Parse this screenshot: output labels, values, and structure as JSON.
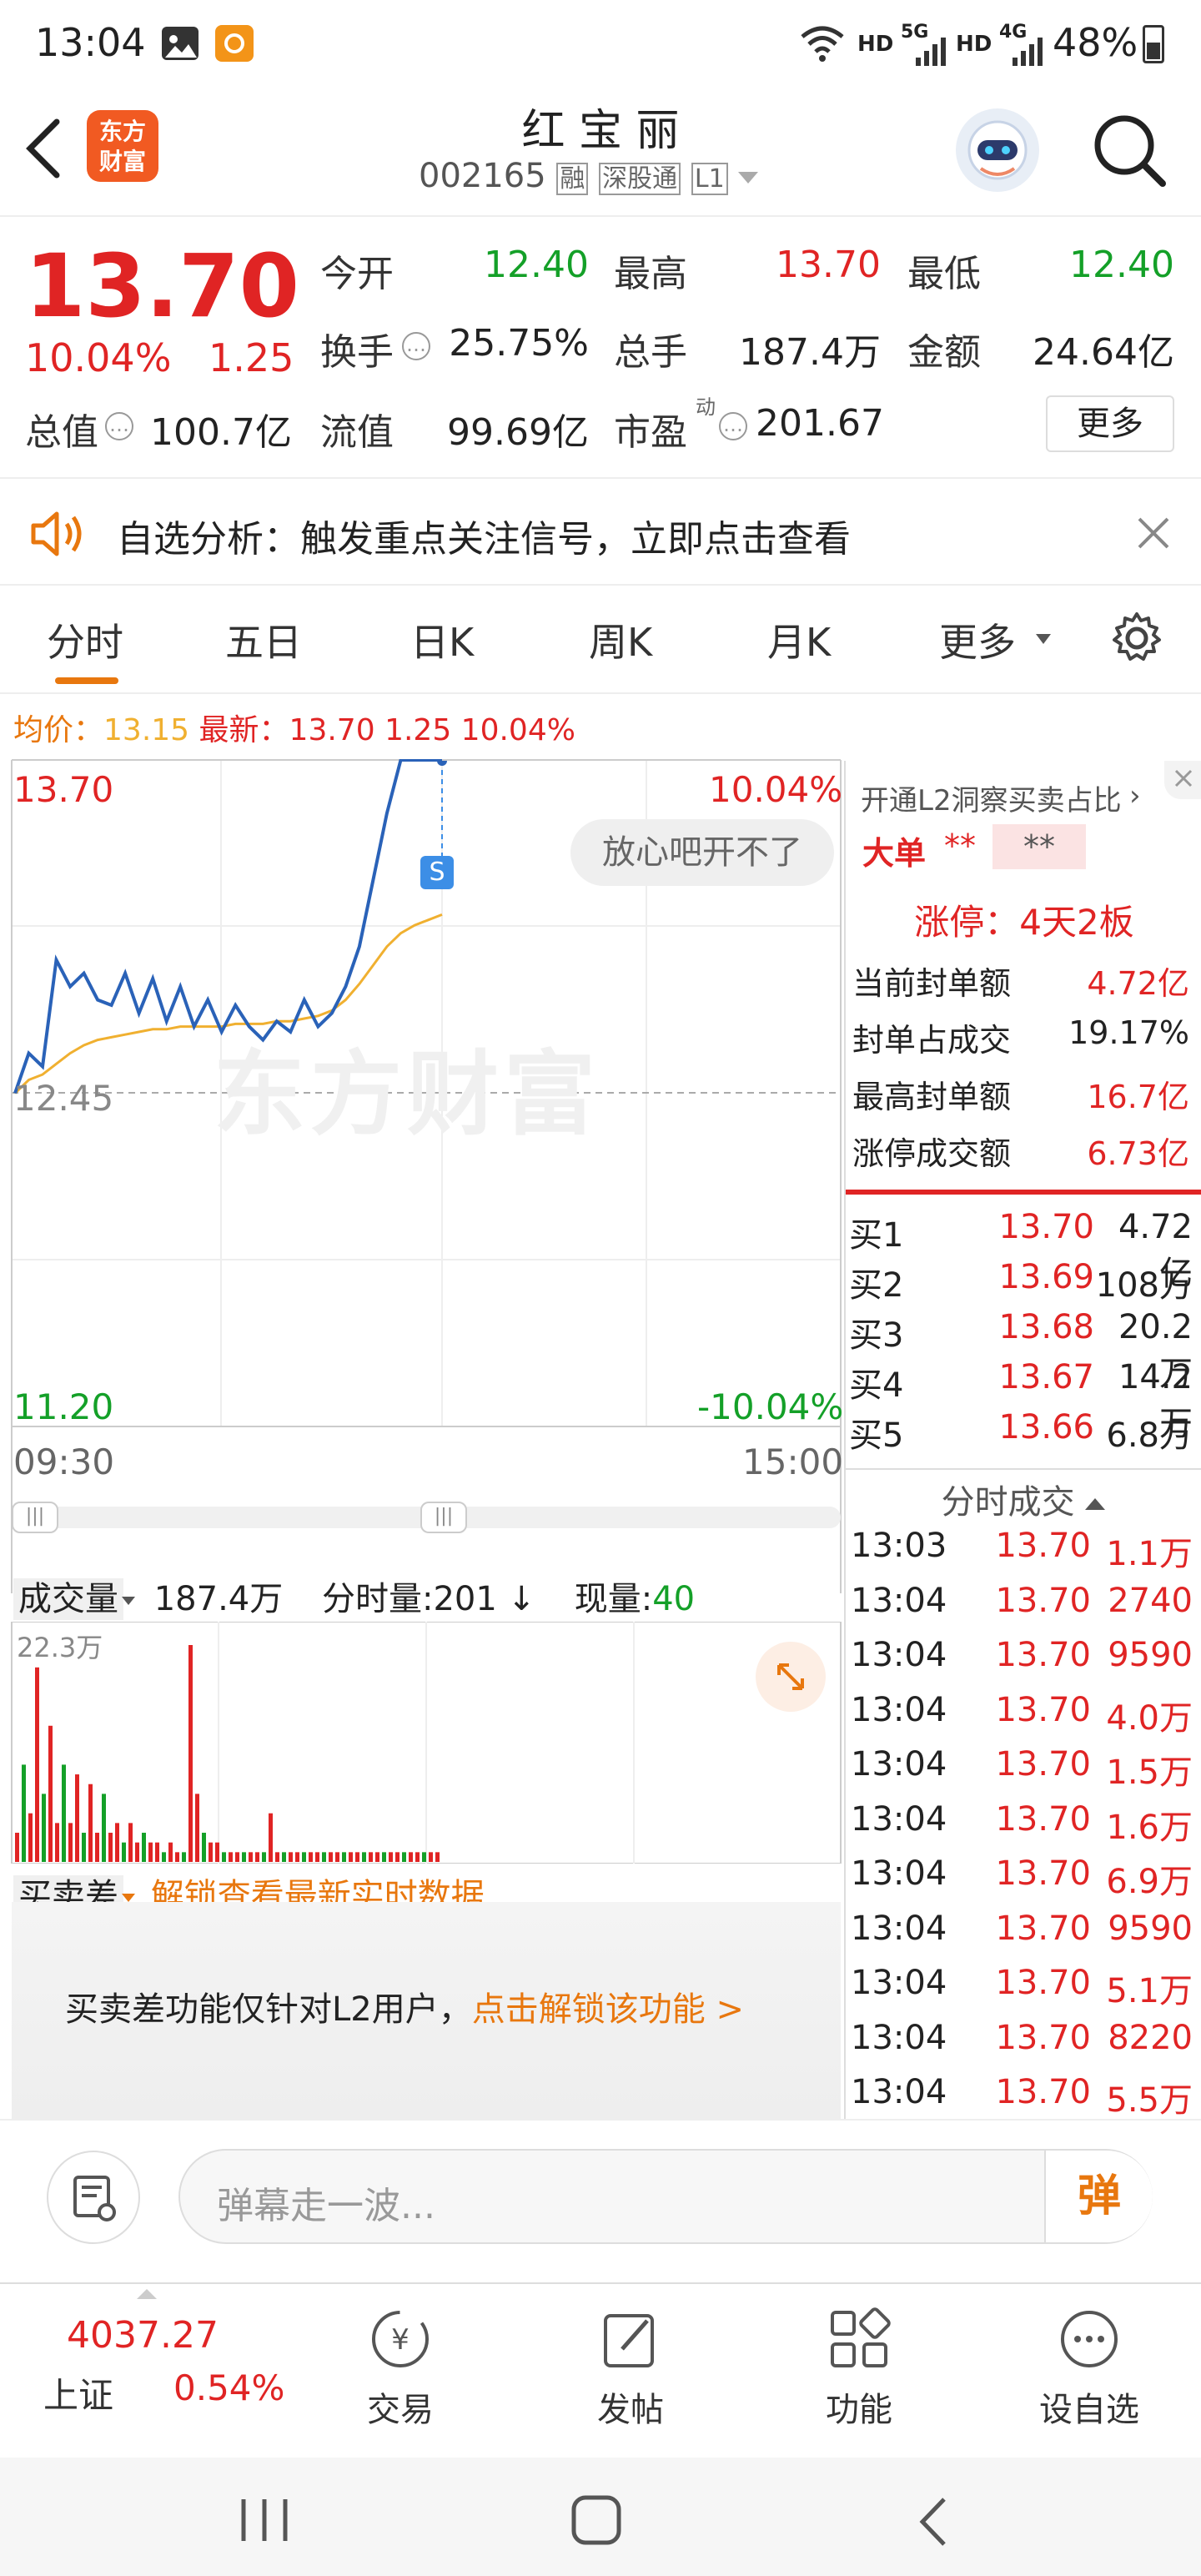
{
  "status_bar": {
    "time": "13:04",
    "net1": "HD",
    "net2": "5G",
    "net3": "HD",
    "net4": "4G",
    "battery": "48%"
  },
  "header": {
    "title": "红 宝 丽",
    "code": "002165",
    "tags": [
      "融",
      "深股通",
      "L1"
    ],
    "logo_line1": "东方",
    "logo_line2": "财富"
  },
  "quote": {
    "price": "13.70",
    "pct": "10.04%",
    "change": "1.25",
    "open_label": "今开",
    "open": "12.40",
    "high_label": "最高",
    "high": "13.70",
    "low_label": "最低",
    "low": "12.40",
    "turnover_label": "换手",
    "turnover": "25.75%",
    "volume_label": "总手",
    "volume": "187.4万",
    "amount_label": "金额",
    "amount": "24.64亿",
    "mktcap_label": "总值",
    "mktcap": "100.7亿",
    "float_label": "流值",
    "float": "99.69亿",
    "pe_label": "市盈",
    "pe_sup": "动",
    "pe": "201.67",
    "more_button": "更多"
  },
  "notice": {
    "text": "自选分析：触发重点关注信号，立即点击查看"
  },
  "tabs": [
    {
      "label": "分时",
      "active": true
    },
    {
      "label": "五日"
    },
    {
      "label": "日K"
    },
    {
      "label": "周K"
    },
    {
      "label": "月K"
    },
    {
      "label": "更多"
    }
  ],
  "chart_info": {
    "avg_label": "均价：",
    "avg": "13.15",
    "latest_label": "最新：",
    "latest": "13.70",
    "change": "1.25",
    "pct": "10.04%"
  },
  "chart_data": {
    "type": "line",
    "y_top": "13.70",
    "y_mid": "12.45",
    "y_bottom": "11.20",
    "pct_top": "10.04%",
    "pct_bottom": "-10.04%",
    "time_start": "09:30",
    "time_end": "15:00",
    "watermark": "东方财富",
    "bubble": "放心吧开不了",
    "marker": "S",
    "series": [
      {
        "name": "最新",
        "color": "#2a62b8",
        "values": [
          12.45,
          12.6,
          12.55,
          12.95,
          12.85,
          12.9,
          12.8,
          12.78,
          12.9,
          12.75,
          12.88,
          12.72,
          12.85,
          12.7,
          12.8,
          12.68,
          12.78,
          12.7,
          12.65,
          12.72,
          12.68,
          12.8,
          12.7,
          12.75,
          12.85,
          13.0,
          13.25,
          13.5,
          13.7,
          13.7,
          13.7,
          13.7
        ]
      },
      {
        "name": "均价",
        "color": "#f0b030",
        "values": [
          12.45,
          12.5,
          12.52,
          12.56,
          12.6,
          12.63,
          12.65,
          12.66,
          12.67,
          12.68,
          12.69,
          12.69,
          12.7,
          12.7,
          12.7,
          12.7,
          12.71,
          12.71,
          12.71,
          12.72,
          12.72,
          12.73,
          12.74,
          12.76,
          12.8,
          12.86,
          12.93,
          13.0,
          13.05,
          13.08,
          13.1,
          13.12
        ]
      }
    ]
  },
  "l2": {
    "title": "开通L2洞察买卖占比",
    "big_label": "大单",
    "big_val1": "**",
    "big_val2": "**",
    "limit_text": "涨停：4天2板",
    "rows": [
      {
        "label": "当前封单额",
        "value": "4.72亿"
      },
      {
        "label": "封单占成交",
        "value": "19.17%"
      },
      {
        "label": "最高封单额",
        "value": "16.7亿"
      },
      {
        "label": "涨停成交额",
        "value": "6.73亿"
      }
    ]
  },
  "orderbook": [
    {
      "label": "买1",
      "price": "13.70",
      "vol": "4.72亿"
    },
    {
      "label": "买2",
      "price": "13.69",
      "vol": "108万"
    },
    {
      "label": "买3",
      "price": "13.68",
      "vol": "20.2万"
    },
    {
      "label": "买4",
      "price": "13.67",
      "vol": "14.2万"
    },
    {
      "label": "买5",
      "price": "13.66",
      "vol": "6.8万"
    }
  ],
  "ticks": {
    "title": "分时成交",
    "rows": [
      {
        "time": "13:03",
        "price": "13.70",
        "vol": "1.1万"
      },
      {
        "time": "13:04",
        "price": "13.70",
        "vol": "2740"
      },
      {
        "time": "13:04",
        "price": "13.70",
        "vol": "9590"
      },
      {
        "time": "13:04",
        "price": "13.70",
        "vol": "4.0万"
      },
      {
        "time": "13:04",
        "price": "13.70",
        "vol": "1.5万"
      },
      {
        "time": "13:04",
        "price": "13.70",
        "vol": "1.6万"
      },
      {
        "time": "13:04",
        "price": "13.70",
        "vol": "6.9万"
      },
      {
        "time": "13:04",
        "price": "13.70",
        "vol": "9590"
      },
      {
        "time": "13:04",
        "price": "13.70",
        "vol": "5.1万"
      },
      {
        "time": "13:04",
        "price": "13.70",
        "vol": "8220"
      },
      {
        "time": "13:04",
        "price": "13.70",
        "vol": "5.5万"
      }
    ]
  },
  "volume_panel": {
    "selector": "成交量",
    "total": "187.4万",
    "intraday_label": "分时量:",
    "intraday": "201",
    "current_label": "现量:",
    "current": "40",
    "max": "22.3万",
    "bars": [
      3,
      10,
      5,
      20,
      7,
      14,
      4,
      10,
      4,
      9,
      3,
      8,
      3,
      7,
      3,
      4,
      2,
      4,
      2,
      3,
      2,
      2,
      1,
      2,
      1,
      1,
      22.3,
      7,
      3,
      2,
      2,
      1,
      1,
      1,
      1,
      1,
      1,
      1,
      5,
      1,
      1,
      1,
      1,
      1,
      1,
      1,
      1,
      1,
      1,
      1,
      1,
      1,
      1,
      1,
      1,
      1,
      1,
      1,
      1,
      1,
      1,
      1,
      1,
      1
    ]
  },
  "spread_panel": {
    "selector": "买卖差",
    "unlock_text": "解锁查看最新实时数据",
    "msg": "买卖差功能仅针对L2用户，",
    "msg_link": "点击解锁该功能 >"
  },
  "input_bar": {
    "placeholder": "弹幕走一波...",
    "danmu_btn": "弹"
  },
  "bottom_nav": {
    "index_value": "4037.27",
    "index_name": "上证",
    "index_pct": "0.54%",
    "items": [
      {
        "label": "交易"
      },
      {
        "label": "发帖"
      },
      {
        "label": "功能"
      },
      {
        "label": "设自选"
      }
    ]
  },
  "colors": {
    "up": "#e02424",
    "down": "#14a028",
    "accent": "#e8770e",
    "price_line": "#2a62b8",
    "avg_line": "#f0b030"
  }
}
